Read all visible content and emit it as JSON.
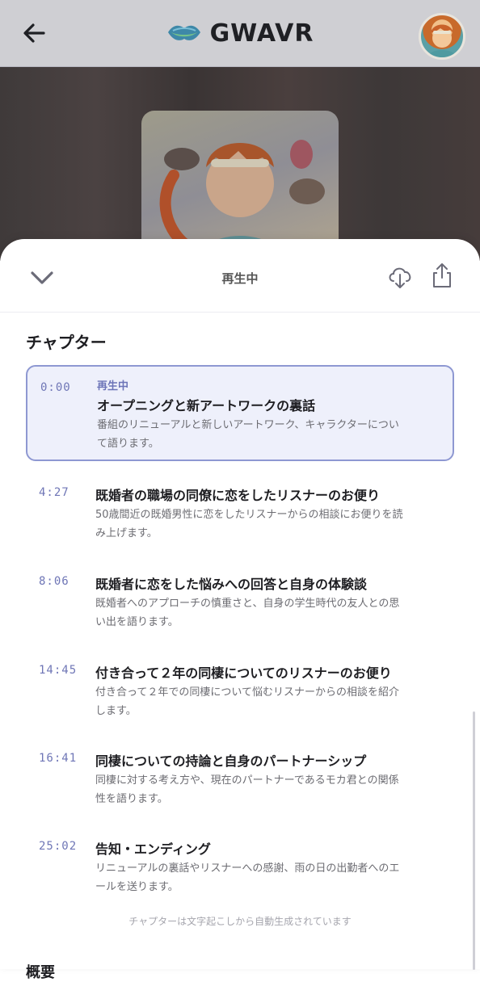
{
  "app": {
    "logo_text": "GWAVR"
  },
  "sheet": {
    "title": "再生中"
  },
  "chapters": {
    "section_title": "チャプター",
    "items": [
      {
        "time": "0:00",
        "now_label": "再生中",
        "title": "オープニングと新アートワークの裏話",
        "desc_1": "番組のリニューアルと新しいアートワーク、キャラクターについ",
        "desc_2": "て語ります。"
      },
      {
        "time": "4:27",
        "title": "既婚者の職場の同僚に恋をしたリスナーのお便り",
        "desc_1": "50歳間近の既婚男性に恋をしたリスナーからの相談にお便りを読",
        "desc_2": "み上げます。"
      },
      {
        "time": "8:06",
        "title": "既婚者に恋をした悩みへの回答と自身の体験談",
        "desc_1": "既婚者へのアプローチの慎重さと、自身の学生時代の友人との思",
        "desc_2": "い出を語ります。"
      },
      {
        "time": "14:45",
        "title": "付き合って２年の同棲についてのリスナーのお便り",
        "desc_1": "付き合って２年での同棲について悩むリスナーからの相談を紹介",
        "desc_2": "します。"
      },
      {
        "time": "16:41",
        "title": "同棲についての持論と自身のパートナーシップ",
        "desc_1": "同棲に対する考え方や、現在のパートナーであるモカ君との関係",
        "desc_2": "性を語ります。"
      },
      {
        "time": "25:02",
        "title": "告知・エンディング",
        "desc_1": "リニューアルの裏話やリスナーへの感謝、雨の日の出勤者へのエ",
        "desc_2": "ールを送ります。"
      }
    ],
    "footnote": "チャプターは文字起こしから自動生成されています",
    "next_heading": "概要"
  },
  "icons": {
    "back": "arrow-left-icon",
    "collapse": "chevron-down-icon",
    "download": "cloud-download-icon",
    "share": "share-icon"
  },
  "colors": {
    "accent": "#6c74b8",
    "active_bg": "#eef0fb",
    "active_border": "#8e98d2"
  }
}
